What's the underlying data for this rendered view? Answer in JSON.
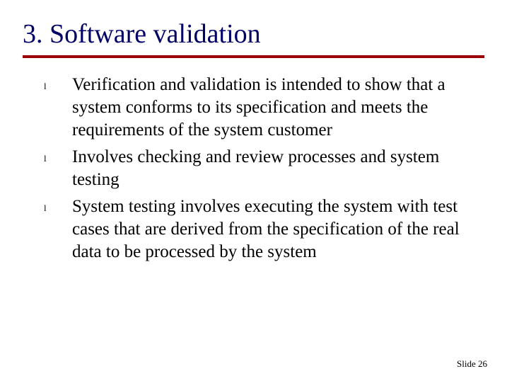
{
  "title": "3. Software validation",
  "bullets": [
    "Verification and validation is intended to show that a system conforms to its specification and meets the requirements of the system customer",
    "Involves checking and review processes and system testing",
    "System testing involves executing the system with test cases that are derived from the specification of the real data to be processed by the system"
  ],
  "bullet_marker": "l",
  "footer": {
    "label": "Slide",
    "number": "26"
  }
}
